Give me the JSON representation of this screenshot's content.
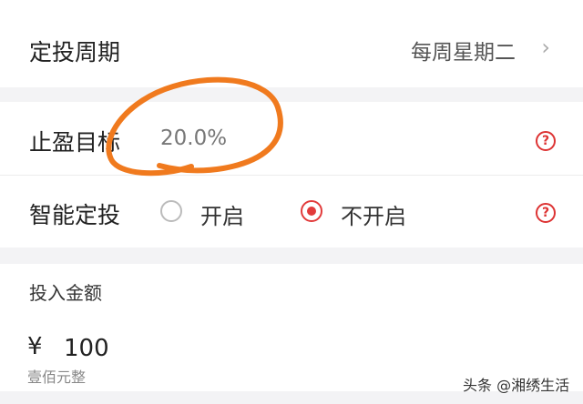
{
  "period": {
    "label": "定投周期",
    "value": "每周星期二",
    "chevron": "chevron-right-icon"
  },
  "stop_profit": {
    "label": "止盈目标",
    "value": "20.0%",
    "help_icon": "?"
  },
  "smart_invest": {
    "label": "智能定投",
    "options": [
      {
        "label": "开启",
        "selected": false
      },
      {
        "label": "不开启",
        "selected": true
      }
    ],
    "help_icon": "?"
  },
  "amount": {
    "title": "投入金额",
    "currency": "¥",
    "value": "100",
    "words": "壹佰元整"
  },
  "watermark": "头条 @湘绣生活",
  "colors": {
    "accent": "#e23b3b",
    "annotation": "#f07a1e",
    "background": "#f3f3f5"
  }
}
